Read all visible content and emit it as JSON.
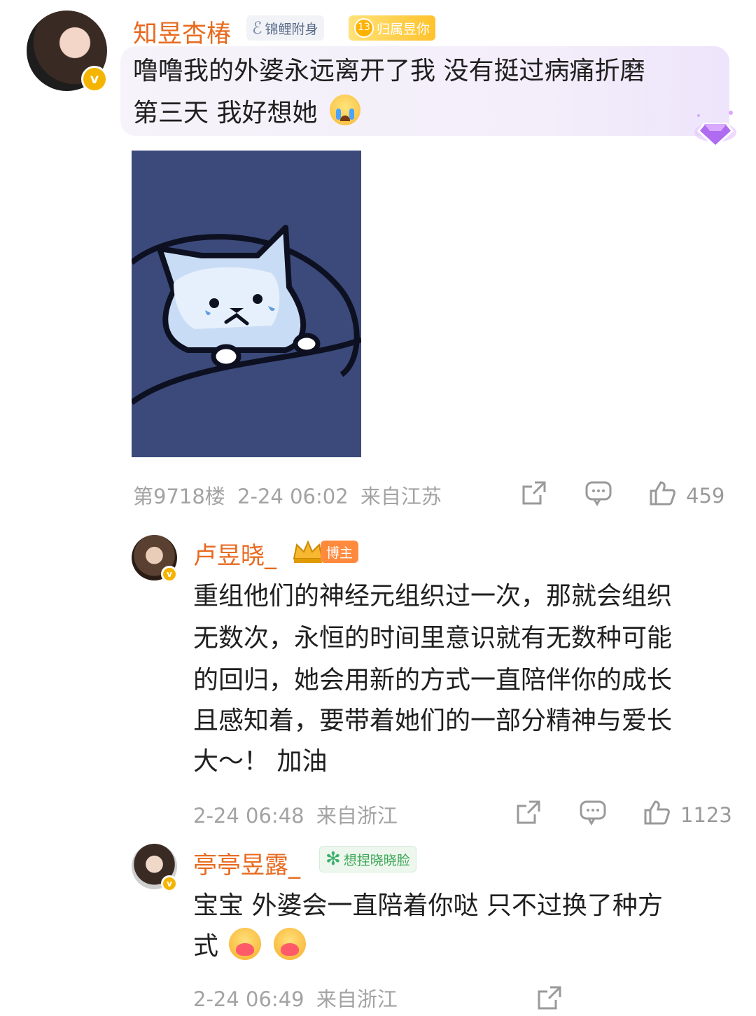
{
  "post": {
    "author": "知昱杏椿",
    "badge_koi": "锦鲤附身",
    "badge_level": "13",
    "badge_fan": "归属昱你",
    "text_line1": "噜噜我的外婆永远离开了我 没有挺过病痛折磨",
    "text_line2": "第三天 我好想她",
    "image_desc_icon": "crying-cat-sticker",
    "floor": "第9718楼",
    "time": "2-24 06:02",
    "location": "来自江苏",
    "likes": "459"
  },
  "replies": [
    {
      "author": "卢昱晓_",
      "badge": "博主",
      "lines": [
        "重组他们的神经元组织过一次，那就会组织",
        "无数次，永恒的时间里意识就有无数种可能",
        "的回归，她会用新的方式一直陪伴你的成长",
        "且感知着，要带着她们的一部分精神与爱长",
        "大～！ 加油"
      ],
      "time": "2-24 06:48",
      "location": "来自浙江",
      "likes": "1123"
    },
    {
      "author": "亭亭昱露_",
      "badge": "想捏晓晓脸",
      "line1": "宝宝 外婆会一直陪着你哒 只不过换了种方",
      "line2": "式",
      "time": "2-24 06:49",
      "location": "来自浙江"
    }
  ],
  "colors": {
    "name": "#e86a1f",
    "meta": "#a3a3a3",
    "verified": "#f5b400",
    "sticker_bg": "#3b4a7a"
  }
}
